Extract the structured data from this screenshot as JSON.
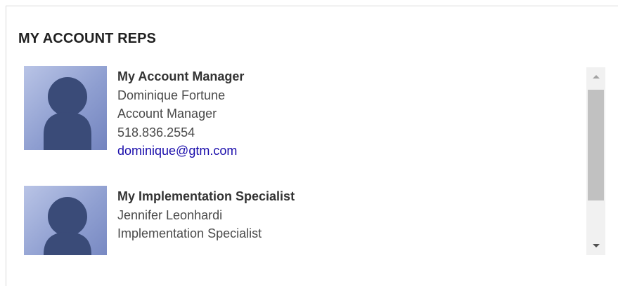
{
  "panel": {
    "title": "MY ACCOUNT REPS"
  },
  "reps": [
    {
      "heading": "My Account Manager",
      "name": "Dominique Fortune",
      "title": "Account Manager",
      "phone": "518.836.2554",
      "email": "dominique@gtm.com",
      "avatar_icon": "person-silhouette-icon"
    },
    {
      "heading": "My Implementation Specialist",
      "name": "Jennifer Leonhardi",
      "title": "Implementation Specialist",
      "avatar_icon": "person-silhouette-icon"
    }
  ],
  "scrollbar": {
    "up_icon": "arrow-up-icon",
    "down_icon": "arrow-down-icon"
  },
  "colors": {
    "link": "#1a0dab",
    "avatar_bg": "#8e9ed0",
    "silhouette": "#3a4b78"
  }
}
